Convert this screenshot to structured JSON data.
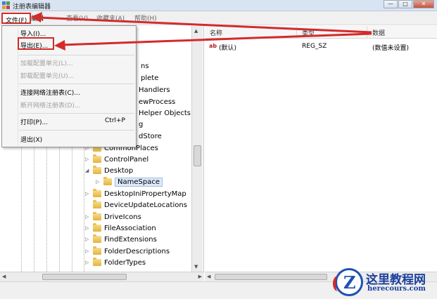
{
  "window": {
    "title": "注册表编辑器",
    "controls": [
      "—",
      "□",
      "✕"
    ]
  },
  "menubar": {
    "file": "文件(F)",
    "edit": "编辑",
    "view": "查看(V)",
    "favorites": "收藏夹(A)",
    "help": "帮助(H)"
  },
  "file_menu": {
    "import": "导入(I)...",
    "export": "导出(E)...",
    "load_hive": "加载配置单元(L)...",
    "unload_hive": "卸载配置单元(U)...",
    "connect": "连接网络注册表(C)...",
    "disconnect": "断开网络注册表(D)...",
    "print": "打印(P)...",
    "print_shortcut": "Ctrl+P",
    "exit": "退出(X)"
  },
  "tree": {
    "partial": [
      "ns",
      "plete",
      "Handlers",
      "ewProcess",
      "Helper Objects",
      "g",
      "dStore"
    ],
    "items": [
      "CommonPlaces",
      "ControlPanel",
      "Desktop",
      "NameSpace",
      "DesktopIniPropertyMap",
      "DeviceUpdateLocations",
      "DriveIcons",
      "FileAssociation",
      "FindExtensions",
      "FolderDescriptions",
      "FolderTypes"
    ]
  },
  "list": {
    "headers": {
      "name": "名称",
      "type": "类型",
      "data": "数据"
    },
    "rows": [
      {
        "icon": "ab",
        "name": "(默认)",
        "type": "REG_SZ",
        "data": "(数值未设置)"
      }
    ]
  },
  "watermark": {
    "cn": "这里教程网",
    "en": "herecours.com"
  },
  "colors": {
    "highlight_red": "#d42a2a",
    "watermark_blue": "#1b3f9a"
  }
}
